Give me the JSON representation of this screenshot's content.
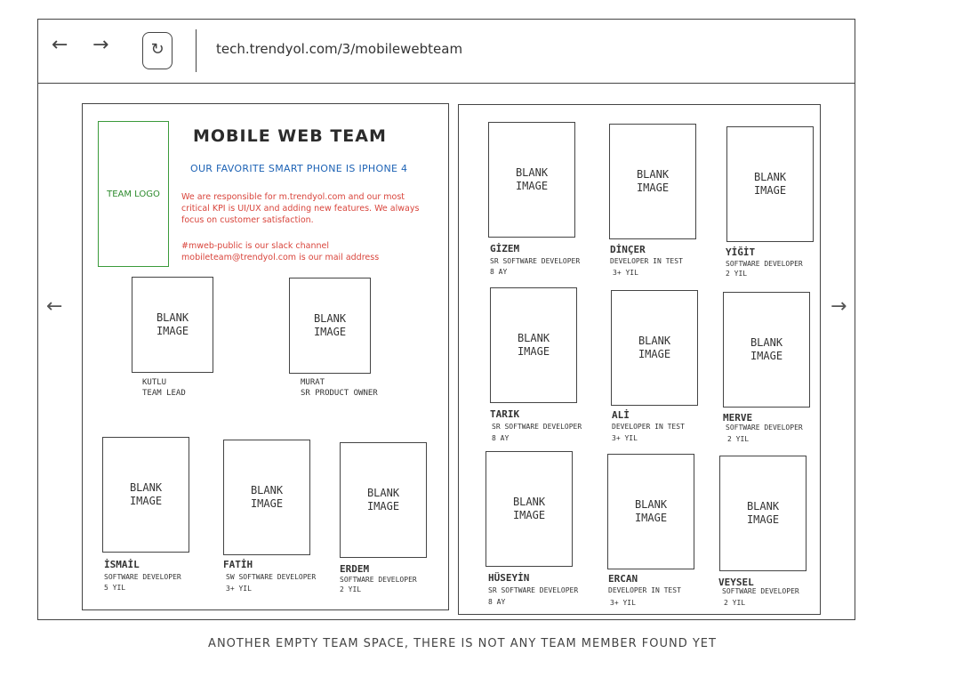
{
  "browser": {
    "url": "tech.trendyol.com/3/mobilewebteam",
    "back_glyph": "←",
    "forward_glyph": "→",
    "reload_glyph": "↻"
  },
  "team": {
    "logo_label": "TEAM LOGO",
    "title": "MOBILE WEB TEAM",
    "subtitle": "OUR FAVORITE SMART PHONE IS IPHONE 4",
    "description": "We are responsible for m.trendyol.com and our most critical KPI is UI/UX and adding new features. We always focus on customer satisfaction.",
    "slack_line": "#mweb-public is our slack channel",
    "mail_line": "mobileteam@trendyol.com is our mail address"
  },
  "placeholder": {
    "line1": "BLANK",
    "line2": "IMAGE"
  },
  "leads": [
    {
      "name": "KUTLU",
      "role": "TEAM LEAD"
    },
    {
      "name": "MURAT",
      "role": "SR PRODUCT OWNER"
    }
  ],
  "left_members": [
    {
      "name": "İSMAİL",
      "role": "SOFTWARE DEVELOPER",
      "tenure": "5 YIL"
    },
    {
      "name": "FATİH",
      "role": "SW SOFTWARE DEVELOPER",
      "tenure": "3+ YIL"
    },
    {
      "name": "ERDEM",
      "role": "SOFTWARE DEVELOPER",
      "tenure": "2 YIL"
    }
  ],
  "right_members": [
    {
      "name": "GİZEM",
      "role": "SR SOFTWARE DEVELOPER",
      "tenure": "8 AY"
    },
    {
      "name": "DİNÇER",
      "role": "DEVELOPER IN TEST",
      "tenure": "3+ YIL"
    },
    {
      "name": "YİĞİT",
      "role": "SOFTWARE DEVELOPER",
      "tenure": "2 YIL"
    },
    {
      "name": "TARIK",
      "role": "SR SOFTWARE DEVELOPER",
      "tenure": "8 AY"
    },
    {
      "name": "ALİ",
      "role": "DEVELOPER IN TEST",
      "tenure": "3+ YIL"
    },
    {
      "name": "MERVE",
      "role": "SOFTWARE DEVELOPER",
      "tenure": "2 YIL"
    },
    {
      "name": "HÜSEYİN",
      "role": "SR SOFTWARE DEVELOPER",
      "tenure": "8 AY"
    },
    {
      "name": "ERCAN",
      "role": "DEVELOPER IN TEST",
      "tenure": "3+ YIL"
    },
    {
      "name": "VEYSEL",
      "role": "SOFTWARE DEVELOPER",
      "tenure": "2 YIL"
    }
  ],
  "carousel": {
    "prev_glyph": "←",
    "next_glyph": "→"
  },
  "footer": "ANOTHER EMPTY TEAM SPACE, THERE IS NOT ANY TEAM MEMBER FOUND YET",
  "colors": {
    "subtitle": "#1e63b5",
    "description": "#d9453c",
    "logo": "#2e8b2e",
    "outline": "#444444"
  }
}
